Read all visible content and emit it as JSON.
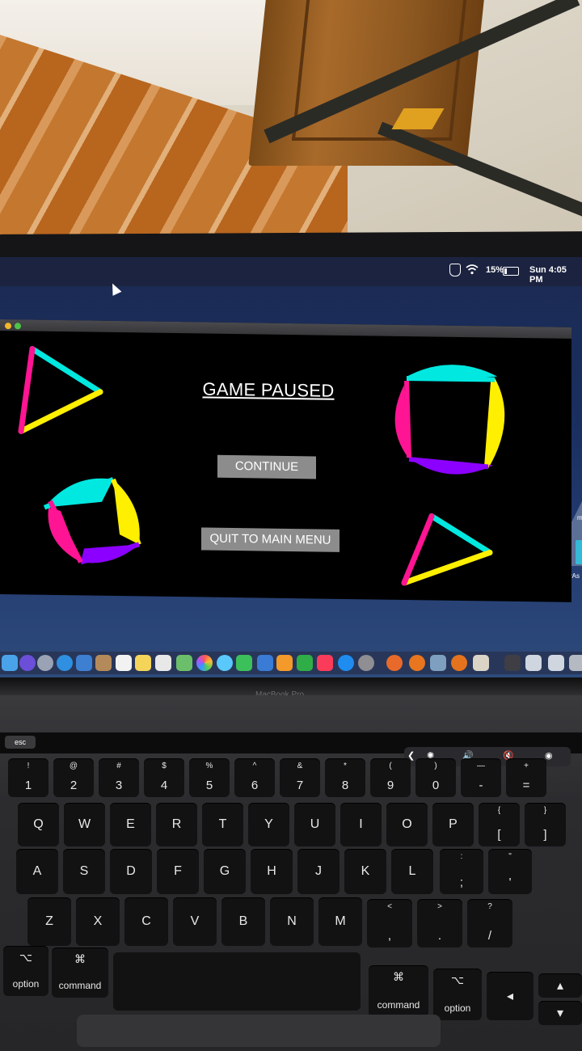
{
  "menubar": {
    "battery": "15%",
    "clock": "Sun 4:05 PM"
  },
  "game": {
    "title": "GAME PAUSED",
    "continue_label": "CONTINUE",
    "quit_label": "QUIT TO MAIN MENU",
    "colors": {
      "cyan": "#00e8e0",
      "yellow": "#ffef00",
      "magenta": "#ff1493",
      "purple": "#8c00ff"
    }
  },
  "desktop": {
    "icon_label": "myAs"
  },
  "laptop": {
    "brand": "MacBook Pro"
  },
  "touchbar": {
    "esc": "esc"
  },
  "keyboard": {
    "numrow": [
      {
        "top": "!",
        "bot": "1"
      },
      {
        "top": "@",
        "bot": "2"
      },
      {
        "top": "#",
        "bot": "3"
      },
      {
        "top": "$",
        "bot": "4"
      },
      {
        "top": "%",
        "bot": "5"
      },
      {
        "top": "^",
        "bot": "6"
      },
      {
        "top": "&",
        "bot": "7"
      },
      {
        "top": "*",
        "bot": "8"
      },
      {
        "top": "(",
        "bot": "9"
      },
      {
        "top": ")",
        "bot": "0"
      },
      {
        "top": "—",
        "bot": "-"
      },
      {
        "top": "+",
        "bot": "="
      }
    ],
    "qrow": [
      "Q",
      "W",
      "E",
      "R",
      "T",
      "Y",
      "U",
      "I",
      "O",
      "P"
    ],
    "brackets": [
      {
        "top": "{",
        "bot": "["
      },
      {
        "top": "}",
        "bot": "]"
      }
    ],
    "arow": [
      "A",
      "S",
      "D",
      "F",
      "G",
      "H",
      "J",
      "K",
      "L"
    ],
    "arow_punct": [
      {
        "top": ":",
        "bot": ";"
      },
      {
        "top": "\"",
        "bot": "'"
      }
    ],
    "zrow": [
      "Z",
      "X",
      "C",
      "V",
      "B",
      "N",
      "M"
    ],
    "zrow_punct": [
      {
        "top": "<",
        "bot": ","
      },
      {
        "top": ">",
        "bot": "."
      },
      {
        "top": "?",
        "bot": "/"
      }
    ],
    "left_option": "option",
    "left_option_sym": "⌥",
    "left_command": "command",
    "left_command_sym": "⌘",
    "right_command": "command",
    "right_command_sym": "⌘",
    "right_option": "option",
    "right_option_sym": "⌥"
  }
}
